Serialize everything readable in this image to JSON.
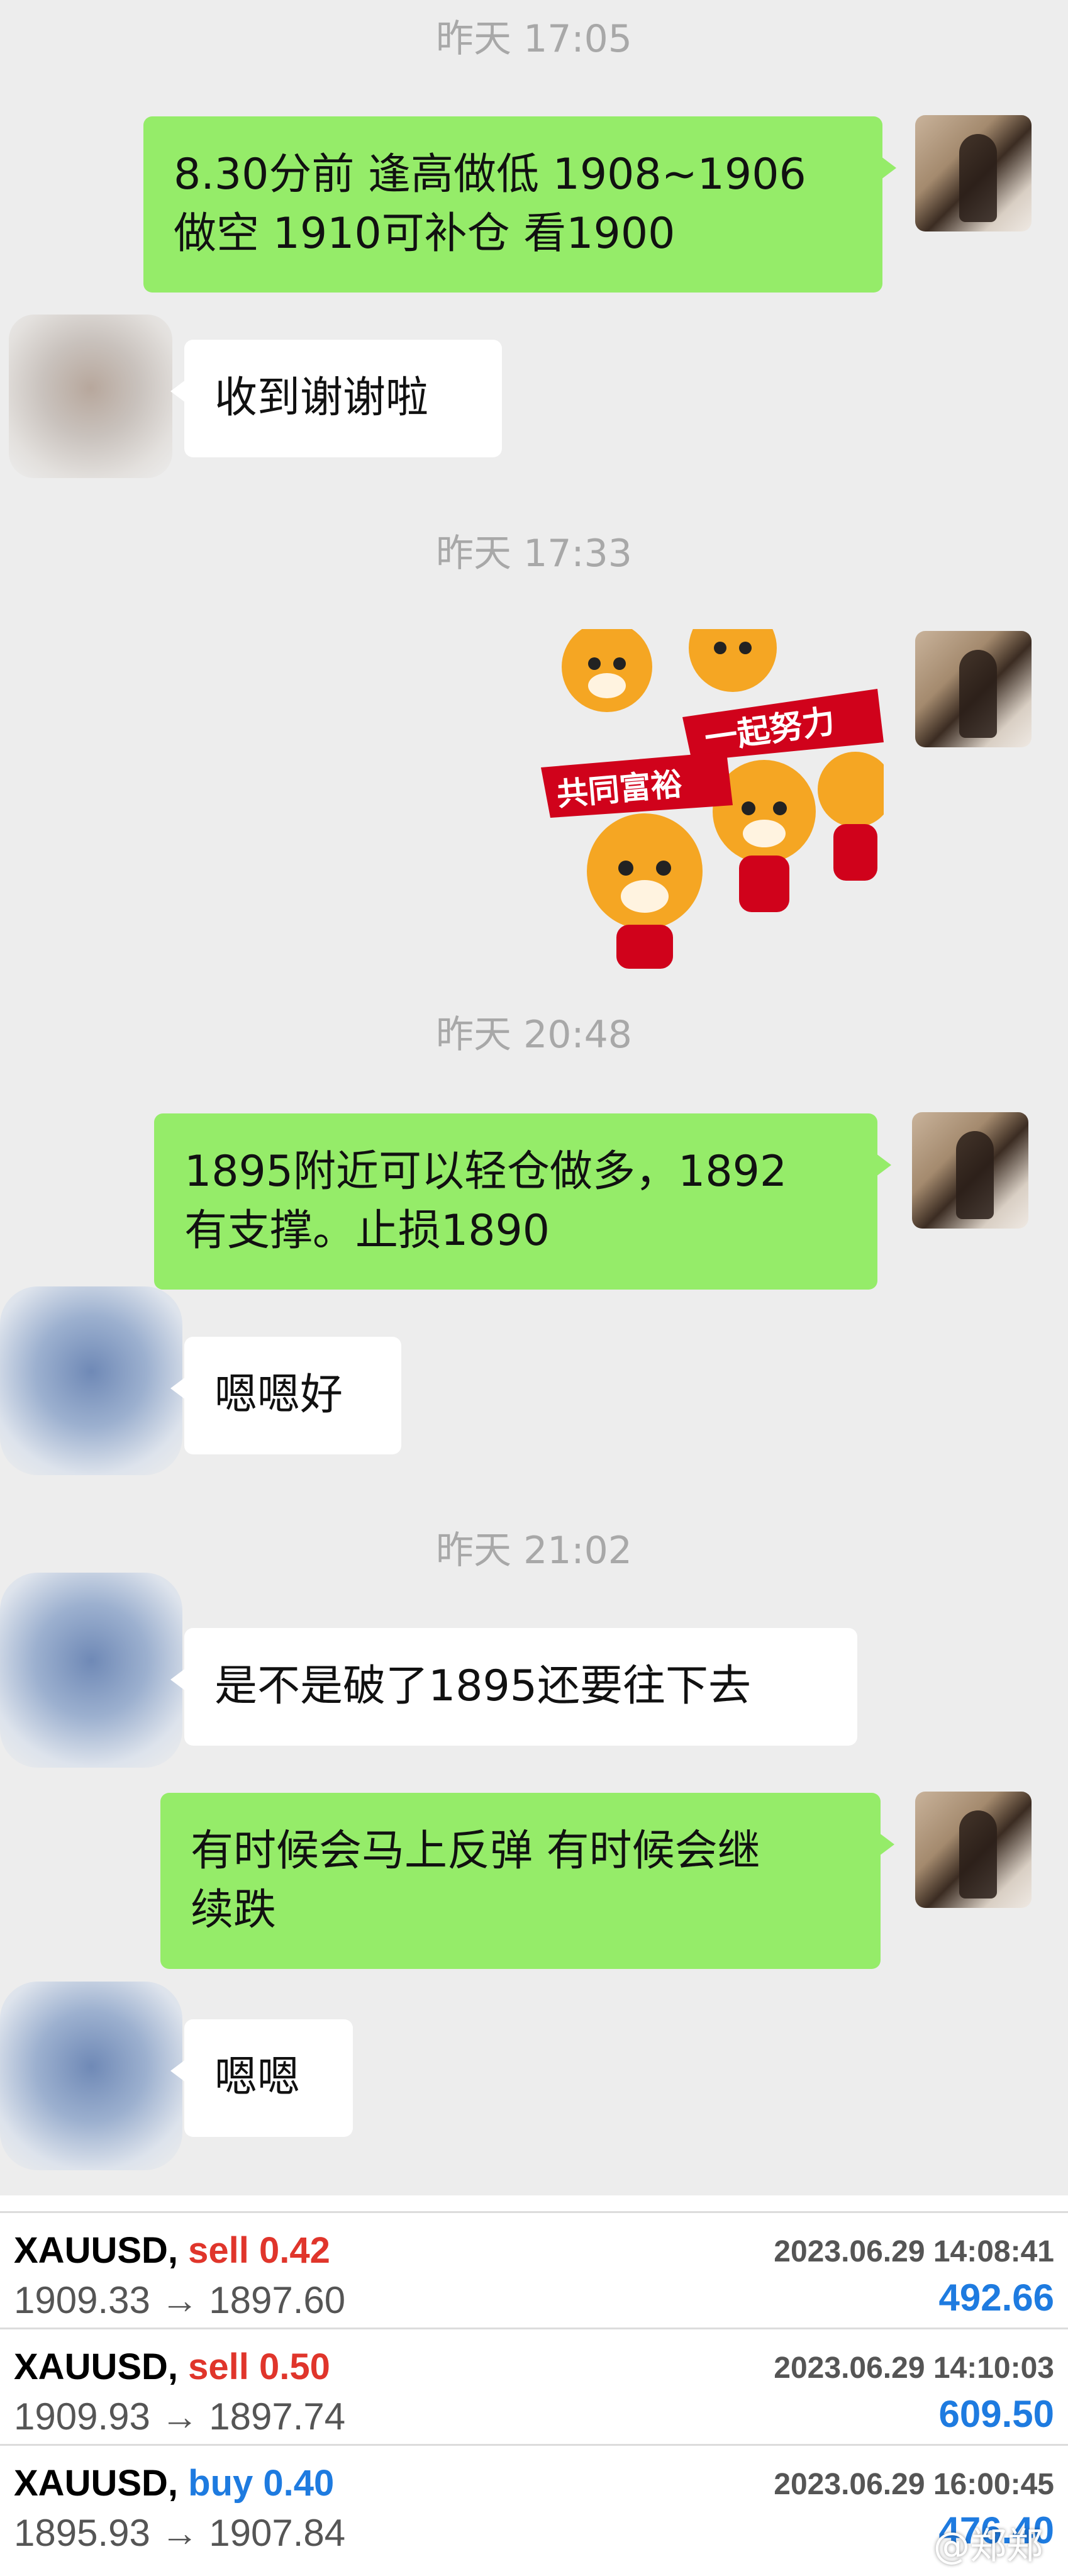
{
  "chat": {
    "timestamps": [
      "昨天 17:05",
      "昨天 17:33",
      "昨天 20:48",
      "昨天 21:02"
    ],
    "messages": [
      {
        "side": "out",
        "lines": [
          "8.30分前 逢高做低 1908~1906",
          "做空 1910可补仓 看1900"
        ]
      },
      {
        "side": "in",
        "lines": [
          "收到谢谢啦"
        ]
      },
      {
        "side": "out",
        "sticker": {
          "banner_left": "共同富裕",
          "banner_right": "一起努力"
        }
      },
      {
        "side": "out",
        "lines": [
          "1895附近可以轻仓做多，1892",
          "有支撑。止损1890"
        ]
      },
      {
        "side": "in",
        "lines": [
          "嗯嗯好"
        ]
      },
      {
        "side": "in",
        "lines": [
          "是不是破了1895还要往下去"
        ]
      },
      {
        "side": "out",
        "lines": [
          "有时候会马上反弹 有时候会继",
          "续跌"
        ]
      },
      {
        "side": "in",
        "lines": [
          "嗯嗯"
        ]
      }
    ]
  },
  "trades": [
    {
      "symbol": "XAUUSD,",
      "side": "sell",
      "volume": "0.42",
      "datetime": "2023.06.29 14:08:41",
      "open_price": "1909.33",
      "arrow": "→",
      "close_price": "1897.60",
      "profit": "492.66"
    },
    {
      "symbol": "XAUUSD,",
      "side": "sell",
      "volume": "0.50",
      "datetime": "2023.06.29 14:10:03",
      "open_price": "1909.93",
      "arrow": "→",
      "close_price": "1897.74",
      "profit": "609.50"
    },
    {
      "symbol": "XAUUSD,",
      "side": "buy",
      "volume": "0.40",
      "datetime": "2023.06.29 16:00:45",
      "open_price": "1895.93",
      "arrow": "→",
      "close_price": "1907.84",
      "profit": "476.40"
    }
  ],
  "watermark": "@郑郑",
  "colors": {
    "outgoing_bubble": "#95ec69",
    "incoming_bubble": "#ffffff",
    "sell": "#e0352b",
    "buy": "#1e7be0",
    "background": "#ededed"
  }
}
